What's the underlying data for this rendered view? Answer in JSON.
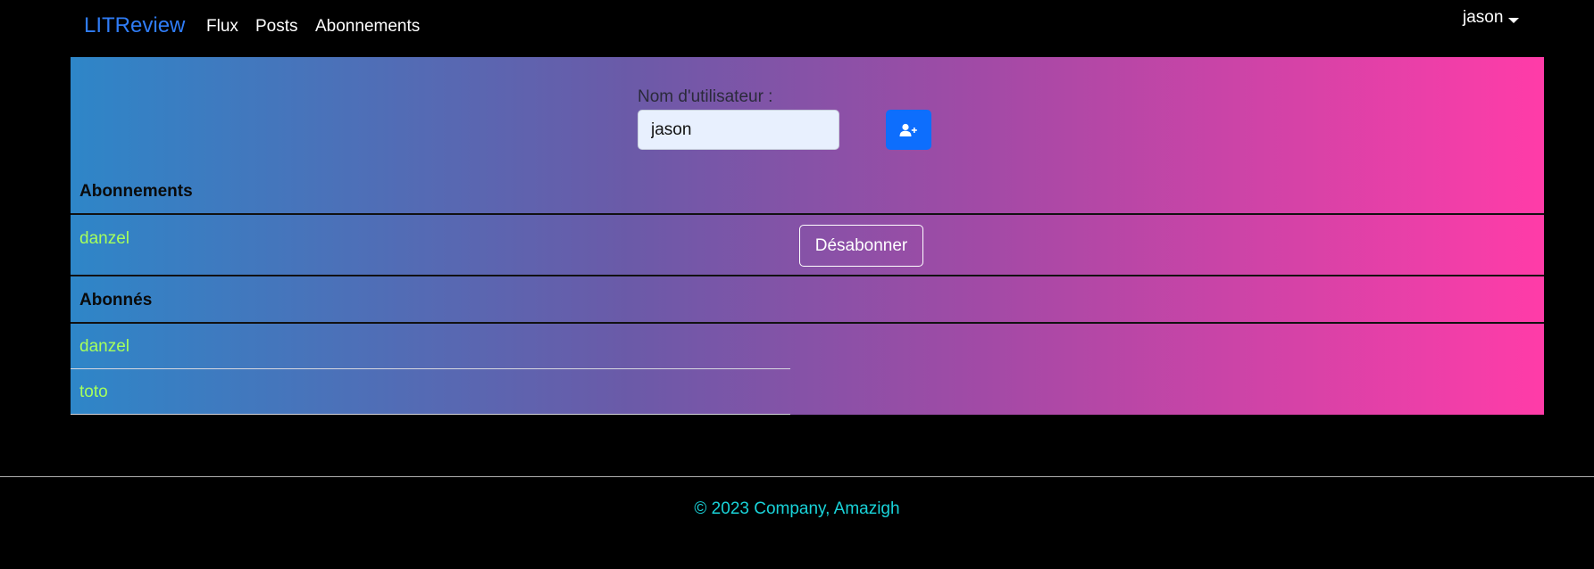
{
  "navbar": {
    "brand": "LITReview",
    "links": [
      "Flux",
      "Posts",
      "Abonnements"
    ],
    "user": "jason"
  },
  "follow_form": {
    "label": "Nom d'utilisateur :",
    "value": "jason",
    "button_icon": "person-plus-icon",
    "button_color": "#0d6efd"
  },
  "subscriptions": {
    "title": "Abonnements",
    "items": [
      {
        "name": "danzel",
        "action_label": "Désabonner"
      }
    ]
  },
  "followers": {
    "title": "Abonnés",
    "items": [
      "danzel",
      "toto"
    ]
  },
  "footer": {
    "text": "© 2023 Company, Amazigh"
  },
  "colors": {
    "brand": "#2f7cf6",
    "username_text": "#a6ff5c",
    "footer_text": "#19d3d9",
    "gradient_start": "#2e86c8",
    "gradient_end": "#ff3ca8"
  }
}
